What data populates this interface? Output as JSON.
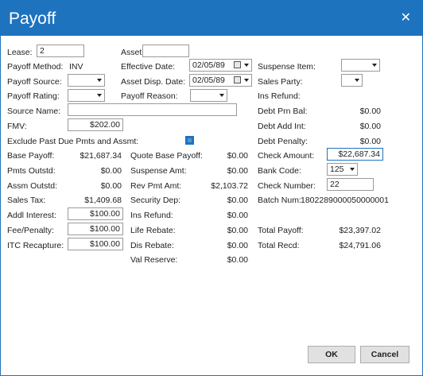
{
  "dialog": {
    "title": "Payoff",
    "close_icon": "close-icon"
  },
  "lease": {
    "label": "Lease:",
    "value": "2"
  },
  "asset": {
    "label": "Asset:",
    "value": ""
  },
  "payoff_method": {
    "label": "Payoff Method:",
    "value": "INV"
  },
  "payoff_source": {
    "label": "Payoff Source:",
    "value": ""
  },
  "payoff_rating": {
    "label": "Payoff Rating:",
    "value": ""
  },
  "source_name": {
    "label": "Source Name:",
    "value": ""
  },
  "fmv": {
    "label": "FMV:",
    "value": "$202.00"
  },
  "exclude_past_due": {
    "label": "Exclude Past Due Pmts and Assmt:",
    "checked": true
  },
  "effective_date": {
    "label": "Effective Date:",
    "value": "02/05/89"
  },
  "asset_disp_date": {
    "label": "Asset Disp. Date:",
    "value": "02/05/89"
  },
  "payoff_reason": {
    "label": "Payoff Reason:",
    "value": ""
  },
  "suspense_item": {
    "label": "Suspense Item:",
    "value": ""
  },
  "sales_party": {
    "label": "Sales Party:",
    "value": ""
  },
  "ins_refund_label": "Ins Refund:",
  "debt_prn_bal": {
    "label": "Debt Prn Bal:",
    "value": "$0.00"
  },
  "debt_add_int": {
    "label": "Debt Add Int:",
    "value": "$0.00"
  },
  "debt_penalty": {
    "label": "Debt Penalty:",
    "value": "$0.00"
  },
  "left_col": {
    "base_payoff": {
      "label": "Base Payoff:",
      "value": "$21,687.34"
    },
    "pmts_outstd": {
      "label": "Pmts Outstd:",
      "value": "$0.00"
    },
    "assm_outstd": {
      "label": "Assm Outstd:",
      "value": "$0.00"
    },
    "sales_tax": {
      "label": "Sales Tax:",
      "value": "$1,409.68"
    },
    "addl_interest": {
      "label": "Addl Interest:",
      "value": "$100.00"
    },
    "fee_penalty": {
      "label": "Fee/Penalty:",
      "value": "$100.00"
    },
    "itc_recapture": {
      "label": "ITC Recapture:",
      "value": "$100.00"
    }
  },
  "mid_col": {
    "quote_base_payoff": {
      "label": "Quote Base Payoff:",
      "value": "$0.00"
    },
    "suspense_amt": {
      "label": "Suspense Amt:",
      "value": "$0.00"
    },
    "rev_pmt_amt": {
      "label": "Rev Pmt Amt:",
      "value": "$2,103.72"
    },
    "security_dep": {
      "label": "Security Dep:",
      "value": "$0.00"
    },
    "ins_refund": {
      "label": "Ins Refund:",
      "value": "$0.00"
    },
    "life_rebate": {
      "label": "Life Rebate:",
      "value": "$0.00"
    },
    "dis_rebate": {
      "label": "Dis Rebate:",
      "value": "$0.00"
    },
    "val_reserve": {
      "label": "Val Reserve:",
      "value": "$0.00"
    }
  },
  "right_col": {
    "check_amount": {
      "label": "Check Amount:",
      "value": "$22,687.34"
    },
    "bank_code": {
      "label": "Bank Code:",
      "value": "125"
    },
    "check_number": {
      "label": "Check Number:",
      "value": "22"
    },
    "batch_num": {
      "label": "Batch Num:",
      "value": "1802289000050000001"
    },
    "total_payoff": {
      "label": "Total Payoff:",
      "value": "$23,397.02"
    },
    "total_recd": {
      "label": "Total Recd:",
      "value": "$24,791.06"
    }
  },
  "buttons": {
    "ok": "OK",
    "cancel": "Cancel"
  },
  "colors": {
    "accent": "#1e73be"
  }
}
